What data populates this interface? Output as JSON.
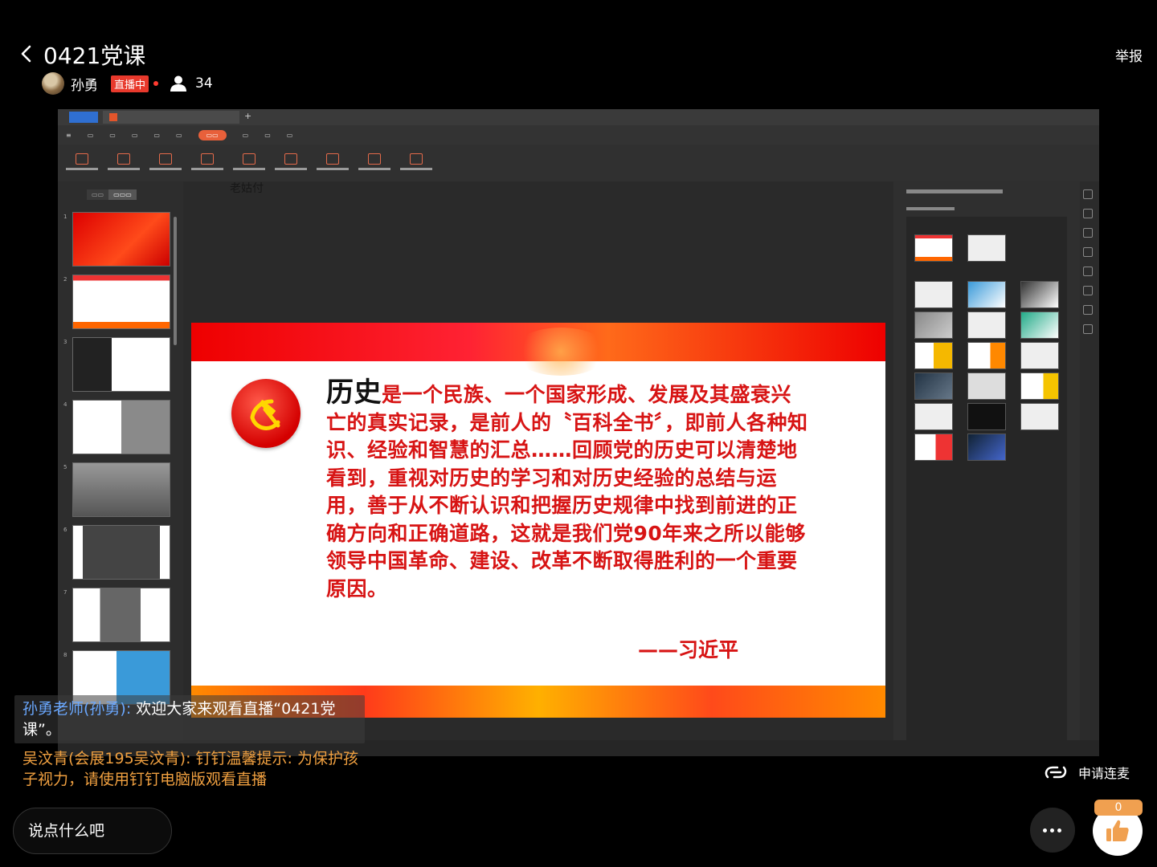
{
  "header": {
    "title": "0421党课",
    "report_label": "举报",
    "host_name": "孙勇",
    "live_badge": "直播中",
    "viewer_count": "34"
  },
  "presentation": {
    "behind_text": "老姑付",
    "slide": {
      "quote_lead": "历史",
      "quote_body": "是一个民族、一个国家形成、发展及其盛衰兴亡的真实记录，是前人的〝百科全书〞，即前人各种知识、经验和智慧的汇总……回顾党的历史可以清楚地看到，重视对历史的学习和对历史经验的总结与运用，善于从不断认识和把握历史规律中找到前进的正确方向和正确道路，这就是我们党90年来之所以能够领导中国革命、建设、改革不断取得胜利的一个重要原因。",
      "author": "——习近平"
    }
  },
  "comments": [
    {
      "user": "孙勇老师(孙勇):",
      "text": " 欢迎大家来观看直播“0421党课”。"
    },
    {
      "user": "吴汶青(会展195吴汶青):",
      "text": " 钉钉温馨提示: 为保护孩子视力，请使用钉钉电脑版观看直播"
    }
  ],
  "connect_label": "申请连麦",
  "input_placeholder": "说点什么吧",
  "like_count": "0",
  "colors": {
    "accent_red": "#d71414",
    "comment_blue": "#6aa8ff",
    "comment_orange": "#f0a040",
    "live_badge": "#e8392c"
  }
}
